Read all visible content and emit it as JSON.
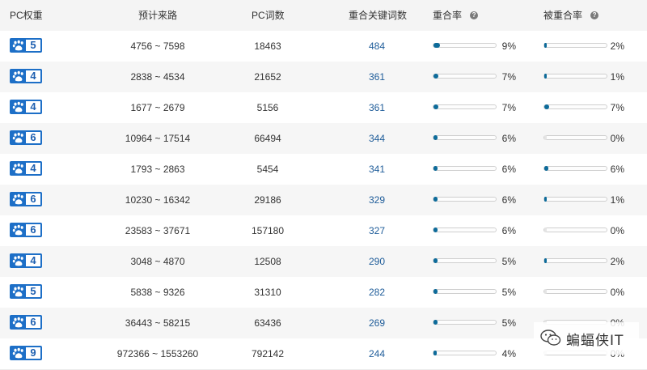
{
  "header": {
    "weight_label": "PC权重",
    "traffic_label": "预计来路",
    "pc_words_label": "PC词数",
    "overlap_kw_label": "重合关键词数",
    "overlap_rate_label": "重合率",
    "overlapped_rate_label": "被重合率",
    "help_icon_glyph": "?"
  },
  "colors": {
    "badge_blue": "#1d6fc7",
    "keyword_link": "#1e5c99",
    "bar_fill": "#0d6b9a",
    "header_bg": "#f4f4f4"
  },
  "rows": [
    {
      "weight": "5",
      "traffic": "4756 ~ 7598",
      "pc_words": "18463",
      "overlap_kw": "484",
      "overlap_rate": "9%",
      "overlap_rate_value": 9,
      "overlapped_rate": "2%",
      "overlapped_rate_value": 2
    },
    {
      "weight": "4",
      "traffic": "2838 ~ 4534",
      "pc_words": "21652",
      "overlap_kw": "361",
      "overlap_rate": "7%",
      "overlap_rate_value": 7,
      "overlapped_rate": "1%",
      "overlapped_rate_value": 1
    },
    {
      "weight": "4",
      "traffic": "1677 ~ 2679",
      "pc_words": "5156",
      "overlap_kw": "361",
      "overlap_rate": "7%",
      "overlap_rate_value": 7,
      "overlapped_rate": "7%",
      "overlapped_rate_value": 7
    },
    {
      "weight": "6",
      "traffic": "10964 ~ 17514",
      "pc_words": "66494",
      "overlap_kw": "344",
      "overlap_rate": "6%",
      "overlap_rate_value": 6,
      "overlapped_rate": "0%",
      "overlapped_rate_value": 0
    },
    {
      "weight": "4",
      "traffic": "1793 ~ 2863",
      "pc_words": "5454",
      "overlap_kw": "341",
      "overlap_rate": "6%",
      "overlap_rate_value": 6,
      "overlapped_rate": "6%",
      "overlapped_rate_value": 6
    },
    {
      "weight": "6",
      "traffic": "10230 ~ 16342",
      "pc_words": "29186",
      "overlap_kw": "329",
      "overlap_rate": "6%",
      "overlap_rate_value": 6,
      "overlapped_rate": "1%",
      "overlapped_rate_value": 1
    },
    {
      "weight": "6",
      "traffic": "23583 ~ 37671",
      "pc_words": "157180",
      "overlap_kw": "327",
      "overlap_rate": "6%",
      "overlap_rate_value": 6,
      "overlapped_rate": "0%",
      "overlapped_rate_value": 0
    },
    {
      "weight": "4",
      "traffic": "3048 ~ 4870",
      "pc_words": "12508",
      "overlap_kw": "290",
      "overlap_rate": "5%",
      "overlap_rate_value": 5,
      "overlapped_rate": "2%",
      "overlapped_rate_value": 2
    },
    {
      "weight": "5",
      "traffic": "5838 ~ 9326",
      "pc_words": "31310",
      "overlap_kw": "282",
      "overlap_rate": "5%",
      "overlap_rate_value": 5,
      "overlapped_rate": "0%",
      "overlapped_rate_value": 0
    },
    {
      "weight": "6",
      "traffic": "36443 ~ 58215",
      "pc_words": "63436",
      "overlap_kw": "269",
      "overlap_rate": "5%",
      "overlap_rate_value": 5,
      "overlapped_rate": "0%",
      "overlapped_rate_value": 0
    },
    {
      "weight": "9",
      "traffic": "972366 ~ 1553260",
      "pc_words": "792142",
      "overlap_kw": "244",
      "overlap_rate": "4%",
      "overlap_rate_value": 4,
      "overlapped_rate": "0%",
      "overlapped_rate_value": 0
    }
  ],
  "watermark": {
    "text": "蝙蝠侠IT",
    "icon": "wechat-icon"
  }
}
